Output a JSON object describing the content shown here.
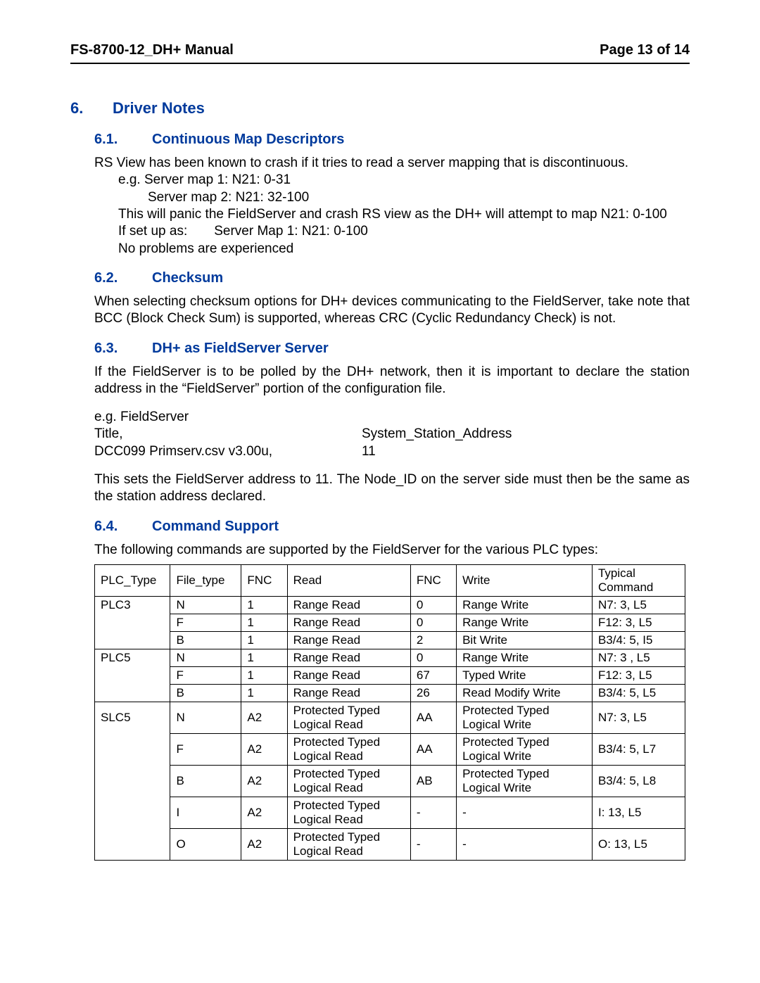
{
  "header": {
    "doc_title": "FS-8700-12_DH+ Manual",
    "page_of": "Page 13 of 14"
  },
  "s6": {
    "num": "6.",
    "title": "Driver Notes"
  },
  "s6_1": {
    "num": "6.1.",
    "title": "Continuous Map Descriptors",
    "p1": "RS View has been known to crash if it tries to read a server mapping that is discontinuous.",
    "eg1": "e.g.  Server map 1:  N21: 0-31",
    "eg2": "Server map 2:  N21: 32-100",
    "p2": "This will panic the FieldServer and crash RS view as the DH+ will attempt to map N21: 0-100",
    "p3": "If set up as:  Server Map 1: N21: 0-100",
    "p4": "No problems are experienced"
  },
  "s6_2": {
    "num": "6.2.",
    "title": "Checksum",
    "p1": "When selecting checksum options for DH+ devices communicating to the FieldServer, take note that BCC (Block Check Sum) is supported, whereas CRC (Cyclic Redundancy Check) is not."
  },
  "s6_3": {
    "num": "6.3.",
    "title": "DH+ as FieldServer Server",
    "p1": "If the FieldServer is to be polled by the DH+ network, then it is important to declare the station address in the “FieldServer” portion of the configuration file.",
    "eg_label": "e.g.  FieldServer",
    "col_title": "Title,",
    "col_ssa": "System_Station_Address",
    "col_value_l": "DCC099 Primserv.csv  v3.00u,",
    "col_value_r": "11",
    "p2": "This sets the FieldServer address to 11.  The Node_ID on the server side must then be the same as the station address declared."
  },
  "s6_4": {
    "num": "6.4.",
    "title": "Command Support",
    "p1": "The following commands are supported by the FieldServer for the various PLC types:",
    "headers": {
      "plc_type": "PLC_Type",
      "file_type": "File_type",
      "fnc1": "FNC",
      "read": "Read",
      "fnc2": "FNC",
      "write": "Write",
      "typical": "Typical Command"
    },
    "rows": [
      {
        "plc": "PLC3",
        "ft": "N",
        "fnc1": "1",
        "read": "Range Read",
        "fnc2": "0",
        "write": "Range Write",
        "typ": "N7: 3, L5"
      },
      {
        "plc": "",
        "ft": "F",
        "fnc1": "1",
        "read": "Range Read",
        "fnc2": "0",
        "write": "Range Write",
        "typ": "F12: 3, L5"
      },
      {
        "plc": "",
        "ft": "B",
        "fnc1": "1",
        "read": "Range Read",
        "fnc2": "2",
        "write": "Bit Write",
        "typ": "B3/4: 5, I5"
      },
      {
        "plc": "PLC5",
        "ft": "N",
        "fnc1": "1",
        "read": "Range Read",
        "fnc2": "0",
        "write": "Range Write",
        "typ": "N7: 3 , L5"
      },
      {
        "plc": "",
        "ft": "F",
        "fnc1": "1",
        "read": "Range Read",
        "fnc2": "67",
        "write": "Typed Write",
        "typ": "F12: 3, L5"
      },
      {
        "plc": "",
        "ft": "B",
        "fnc1": "1",
        "read": "Range Read",
        "fnc2": "26",
        "write": "Read Modify Write",
        "typ": "B3/4: 5, L5"
      },
      {
        "plc": "SLC5",
        "ft": "N",
        "fnc1": "A2",
        "read": "Protected Typed Logical Read",
        "fnc2": "AA",
        "write": "Protected Typed Logical Write",
        "typ": "N7: 3, L5"
      },
      {
        "plc": "",
        "ft": "F",
        "fnc1": "A2",
        "read": "Protected Typed Logical Read",
        "fnc2": "AA",
        "write": "Protected Typed Logical Write",
        "typ": "B3/4: 5, L7"
      },
      {
        "plc": "",
        "ft": "B",
        "fnc1": "A2",
        "read": "Protected Typed Logical Read",
        "fnc2": "AB",
        "write": "Protected Typed Logical Write",
        "typ": "B3/4: 5, L8"
      },
      {
        "plc": "",
        "ft": "I",
        "fnc1": "A2",
        "read": "Protected Typed Logical Read",
        "fnc2": "-",
        "write": "-",
        "typ": "I: 13, L5"
      },
      {
        "plc": "",
        "ft": "O",
        "fnc1": "A2",
        "read": "Protected Typed Logical Read",
        "fnc2": "-",
        "write": "-",
        "typ": "O: 13, L5"
      }
    ]
  }
}
